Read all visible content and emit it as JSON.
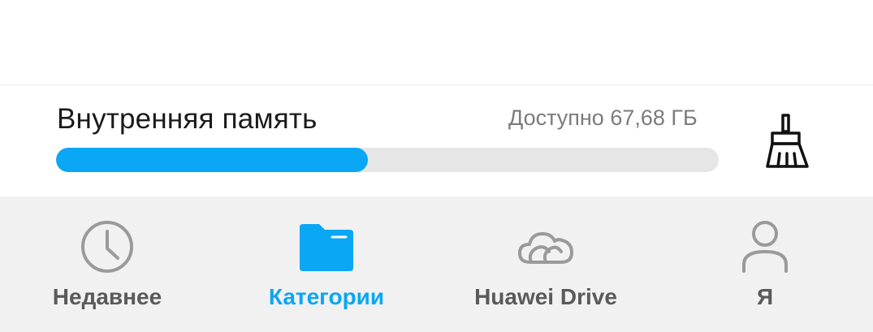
{
  "storage": {
    "title": "Внутренняя память",
    "available": "Доступно 67,68 ГБ",
    "used_fraction": 0.47,
    "clean_icon": "broom-icon"
  },
  "nav": {
    "active_index": 1,
    "items": [
      {
        "label": "Недавнее",
        "icon": "clock-icon"
      },
      {
        "label": "Категории",
        "icon": "folder-icon"
      },
      {
        "label": "Huawei Drive",
        "icon": "cloud-icon"
      },
      {
        "label": "Я",
        "icon": "person-icon"
      }
    ]
  },
  "colors": {
    "accent": "#0aa7f5",
    "track": "#e6e6e6",
    "nav_background": "#f1f1f1",
    "inactive_icon": "#9a9a9a",
    "inactive_label": "#5a5a5a"
  }
}
